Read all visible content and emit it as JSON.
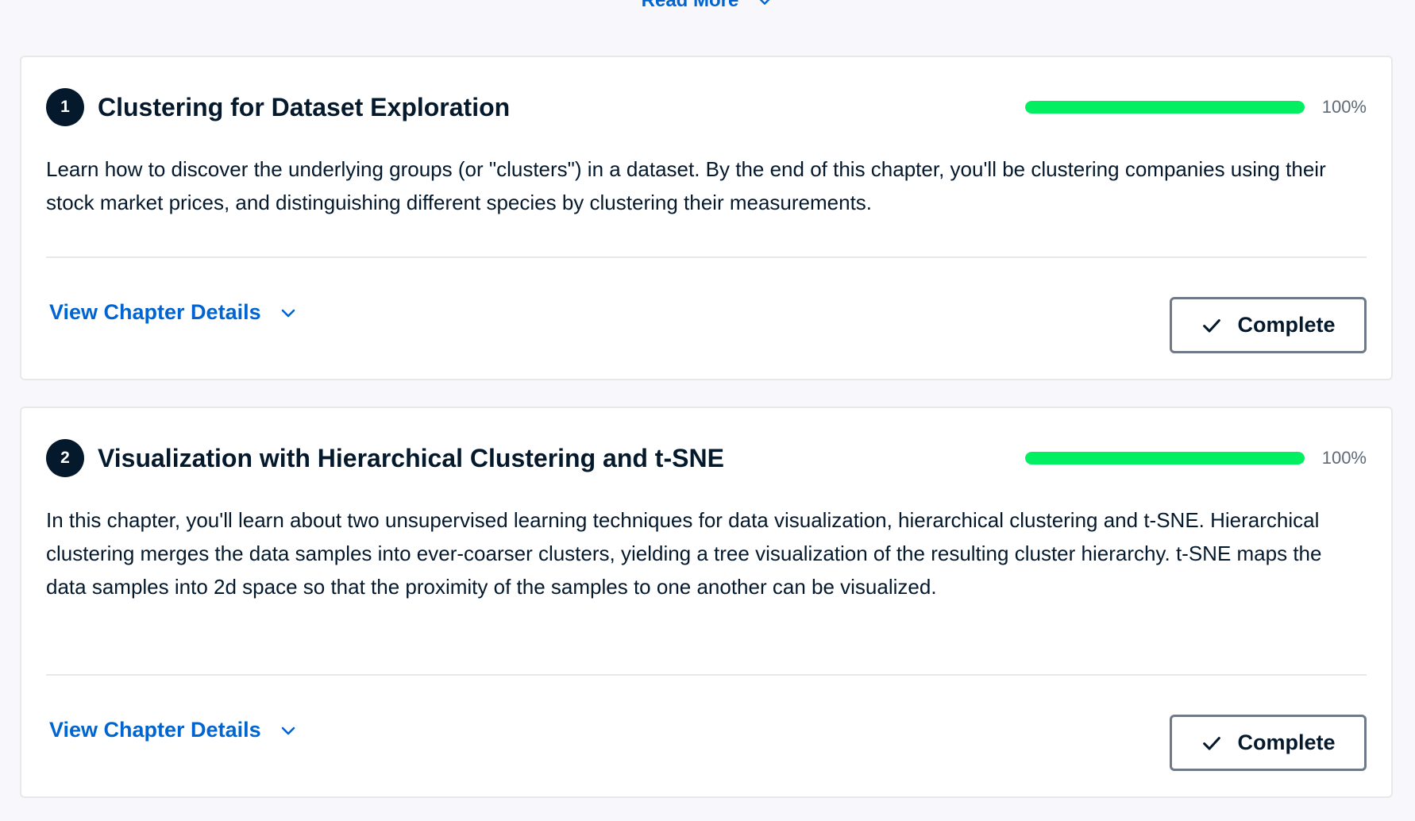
{
  "read_more": {
    "label": "Read More",
    "icon": "chevron-down-icon"
  },
  "colors": {
    "background": "#f7f7fc",
    "card": "#ffffff",
    "link": "#0065d1",
    "progress_fill": "#03ef62",
    "text": "#05192d"
  },
  "chapters": [
    {
      "number": "1",
      "title": "Clustering for Dataset Exploration",
      "progress": 1.0,
      "progress_label": "100%",
      "description": "Learn how to discover the underlying groups (or \"clusters\") in a dataset. By the end of this chapter, you'll be clustering companies using their stock market prices, and distinguishing different species by clustering their measurements.",
      "details_label": "View Chapter Details",
      "complete_label": "Complete",
      "complete_icon": "checkmark-icon"
    },
    {
      "number": "2",
      "title": "Visualization with Hierarchical Clustering and t-SNE",
      "progress": 1.0,
      "progress_label": "100%",
      "description": "In this chapter, you'll learn about two unsupervised learning techniques for data visualization, hierarchical clustering and t-SNE. Hierarchical clustering merges the data samples into ever-coarser clusters, yielding a tree visualization of the resulting cluster hierarchy. t-SNE maps the data samples into 2d space so that the proximity of the samples to one another can be visualized.",
      "details_label": "View Chapter Details",
      "complete_label": "Complete",
      "complete_icon": "checkmark-icon"
    }
  ]
}
